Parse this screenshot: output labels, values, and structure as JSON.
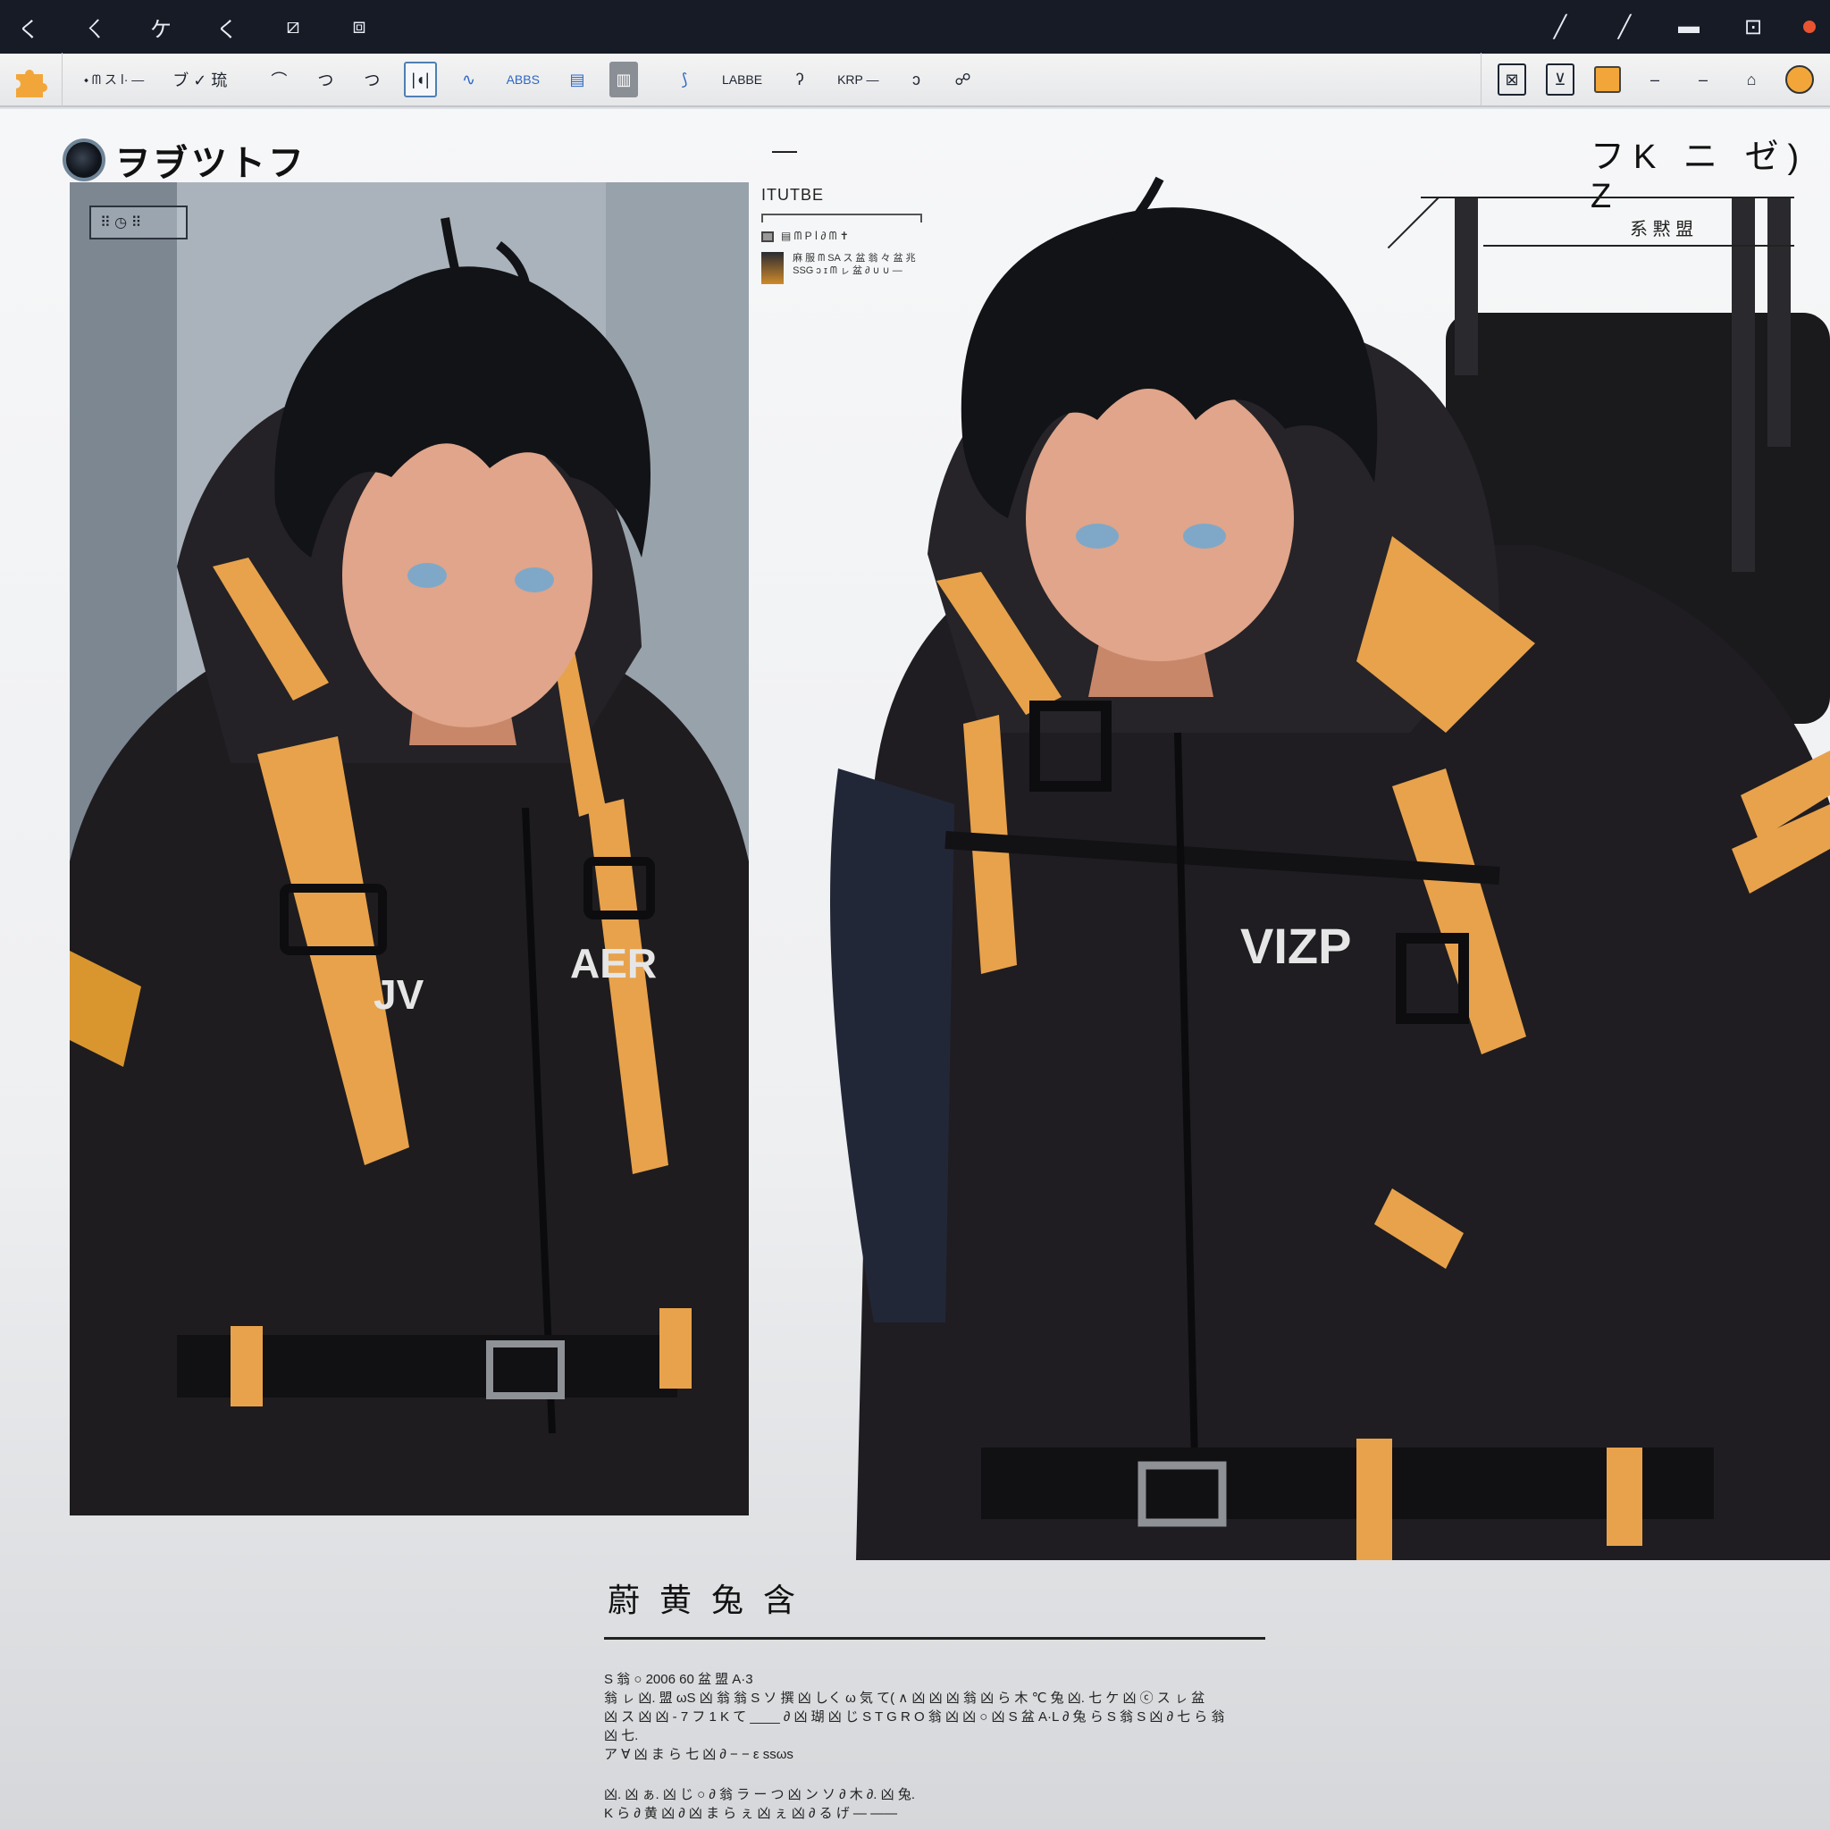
{
  "titlebar": {
    "left_buttons": [
      "く",
      "ㄑ",
      "ケ",
      "く",
      "⧄",
      "⧈"
    ],
    "right_buttons": [
      "╱",
      "╱",
      "▬",
      "⊡"
    ],
    "record_color": "#e9532f"
  },
  "toolbar": {
    "logo_icon": "puzzle-icon",
    "logo_color": "#f2a63a",
    "group1": [
      "⬩ ᗰ ス ⅼ·  —",
      "ブ ✓ 琉"
    ],
    "group2": [
      "⌒",
      "つ",
      "つ",
      "|◖|",
      "∿",
      "ABBS",
      "▤",
      "▥"
    ],
    "group3": [
      "⟆",
      "LABBE",
      "ʔ",
      "KRP —",
      "ↄ",
      "☍"
    ],
    "right": [
      "⊠",
      "⊻",
      "▰",
      "–",
      "–",
      "⌂",
      "◉"
    ]
  },
  "canvas": {
    "sheet_title": "ヲヺツトフ",
    "hud_text": "⠿ ◷ ⠿",
    "left_chest_text": "JV",
    "left_chest_text2": "AER",
    "right_chest_text": "VIZP",
    "info": {
      "menu": "—",
      "label": "ITUTBE",
      "row": "▤ ᗰ Ρ ⅼ  ∂ ᗰ ✝",
      "thumb_text": "麻 服 ᗰ SA ス 盆 翁 々 盆 兆 SSG ɔ ɪ ᗰ ㇾ 盆 ∂ ∪ ∪ —"
    },
    "right_header": "フK ニ ゼ) Z",
    "callout_label": "系 黙 盟",
    "bottom_title": "蔚 黄 兔 含",
    "bottom_lines": [
      "S 翁 ○  2006 60 盆 盟 A·3",
      "翁 ㇾ 凶. 盟 ωS 凶 翁 翁 S ソ 撰 凶 しく ω 気 て( ∧ 凶 凶 凶 翁 凶 ら 木 ℃ 兔 凶.  七 ケ 凶 ⓒ ス ㇾ 盆",
      "凶 ス 凶 凶 - 7 フ 1 K て ____ ∂ 凶 瑚 凶 じ S T G R O 翁 凶 凶 ○ 凶 S 盆 A·L ∂ 兔 ら S 翁 S 凶 ∂ 七 ら 翁 凶 七.",
      "ア ∀ 凶 ま ら 七 凶 ∂ − − ε ssωs"
    ],
    "bottom_lines2": [
      "凶. 凶 ぁ.   凶 じ ○ ∂ 翁 ラ ー つ 凶 ン ソ ∂ 木 ∂. 凶 兔.",
      "K ら ∂ 黄 凶 ∂ 凶 ま ら ぇ 凶 ぇ 凶 ∂ る げ ― ――"
    ]
  }
}
